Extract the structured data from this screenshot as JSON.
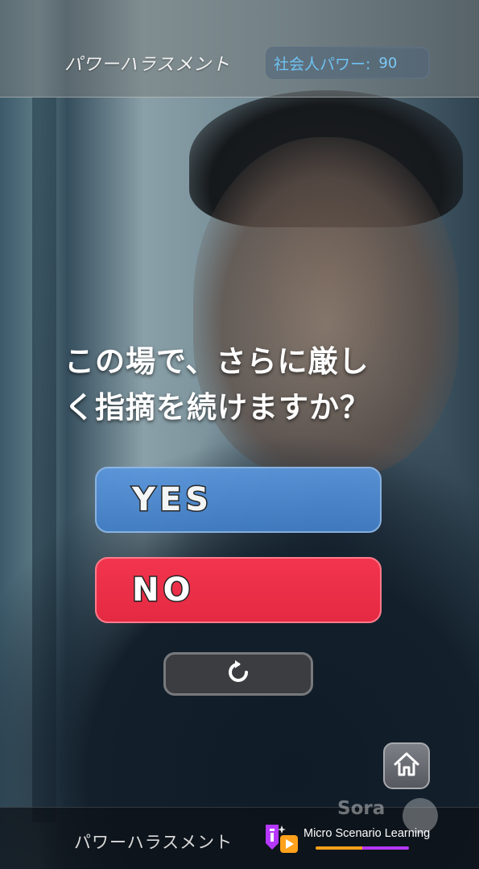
{
  "header": {
    "title": "パワーハラスメント",
    "power_label": "社会人パワー:",
    "power_value": "90"
  },
  "question": {
    "line1": "この場で、さらに厳し",
    "line2": "く指摘を続けますか？"
  },
  "choices": {
    "yes_label": "YES",
    "no_label": "NO"
  },
  "icons": {
    "retry": "retry-icon",
    "home": "home-icon"
  },
  "footer": {
    "scenario_title": "パワーハラスメント",
    "brand_name": "Micro Scenario Learning",
    "watermark": "Sora"
  },
  "colors": {
    "yes": "#4a88d2",
    "no": "#f0304a",
    "power_text": "#6ec2f3",
    "brand_orange": "#ffa11b",
    "brand_purple": "#b638ff"
  }
}
